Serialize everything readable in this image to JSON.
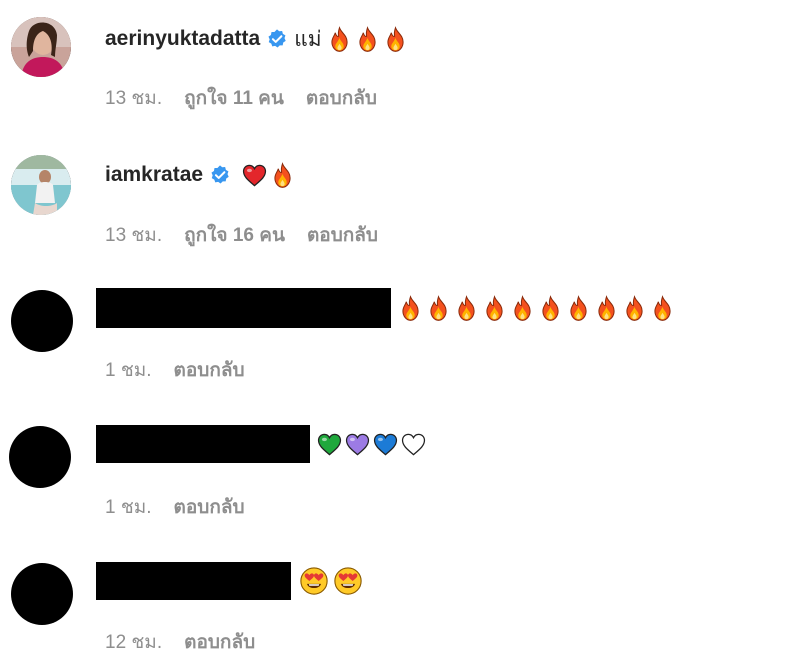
{
  "comments": [
    {
      "username": "aerinyuktadatta",
      "verified": true,
      "text": "แม่",
      "emojis": [
        "fire-icon",
        "fire-icon",
        "fire-icon"
      ],
      "time": "13 ชม.",
      "likes": "ถูกใจ 11 คน",
      "reply": "ตอบกลับ"
    },
    {
      "username": "iamkratae",
      "verified": true,
      "text": "",
      "emojis": [
        "red-heart-icon",
        "fire-icon"
      ],
      "time": "13 ชม.",
      "likes": "ถูกใจ 16 คน",
      "reply": "ตอบกลับ"
    },
    {
      "username": "",
      "redacted": true,
      "emojis": [
        "fire-icon",
        "fire-icon",
        "fire-icon",
        "fire-icon",
        "fire-icon",
        "fire-icon",
        "fire-icon",
        "fire-icon",
        "fire-icon",
        "fire-icon"
      ],
      "time": "1 ชม.",
      "reply": "ตอบกลับ"
    },
    {
      "username": "",
      "redacted": true,
      "emojis": [
        "green-heart-icon",
        "purple-heart-icon",
        "blue-heart-icon",
        "white-heart-icon"
      ],
      "time": "1 ชม.",
      "reply": "ตอบกลับ"
    },
    {
      "username": "",
      "redacted": true,
      "emojis": [
        "heart-eyes-face-icon",
        "heart-eyes-face-icon"
      ],
      "time": "12 ชม.",
      "reply": "ตอบกลับ"
    }
  ],
  "colors": {
    "verified_blue": "#3897f0",
    "meta_gray": "#8e8e8e",
    "username_text": "#262626"
  }
}
